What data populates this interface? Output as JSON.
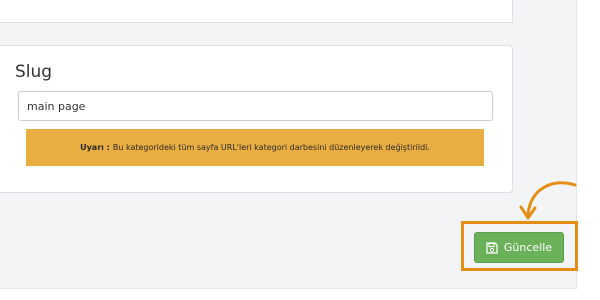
{
  "slug_section": {
    "title": "Slug",
    "input_value": "main page"
  },
  "warning": {
    "label": "Uyarı :",
    "text": "Bu kategorideki tüm sayfa URL'leri kategori darbesini düzenleyerek değiştirildi."
  },
  "actions": {
    "save_label": "Güncelle",
    "save_icon": "floppy-disk-icon"
  },
  "colors": {
    "warning_bg": "#e9ae42",
    "button_bg": "#6ab15a",
    "annotation": "#e58e15"
  }
}
